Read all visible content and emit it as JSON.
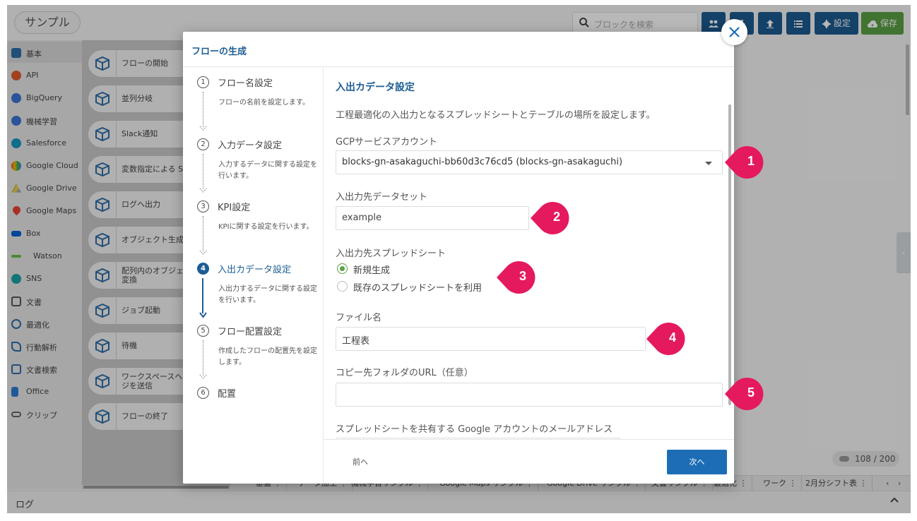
{
  "app": {
    "title": "サンプル",
    "search_placeholder": "ブロックを検索",
    "toolbar": {
      "settings_label": "設定",
      "save_label": "保存"
    }
  },
  "sidebar": {
    "items": [
      {
        "label": "基本",
        "icon": "basic-icon",
        "color": "#2f6ea8"
      },
      {
        "label": "API",
        "icon": "api-icon",
        "color": "#e05a2c"
      },
      {
        "label": "BigQuery",
        "icon": "bigquery-icon",
        "color": "#3b73d6"
      },
      {
        "label": "機械学習",
        "icon": "ml-icon",
        "color": "#3b73d6"
      },
      {
        "label": "Salesforce",
        "icon": "salesforce-icon",
        "color": "#1798c1"
      },
      {
        "label": "Google Cloud",
        "icon": "google-cloud-icon",
        "color": "#ea4335"
      },
      {
        "label": "Google Drive",
        "icon": "google-drive-icon",
        "color": "#1fa463"
      },
      {
        "label": "Google Maps",
        "icon": "google-maps-icon",
        "color": "#ea4335"
      },
      {
        "label": "Box",
        "icon": "box-icon",
        "color": "#0061d5"
      },
      {
        "label": "Watson",
        "icon": "watson-icon",
        "color": "#6bbd45"
      },
      {
        "label": "SNS",
        "icon": "sns-icon",
        "color": "#1ba4a4"
      },
      {
        "label": "文書",
        "icon": "document-icon",
        "color": "#555555"
      },
      {
        "label": "最適化",
        "icon": "optimization-icon",
        "color": "#2f6ea8"
      },
      {
        "label": "行動解析",
        "icon": "behavior-icon",
        "color": "#2f6ea8"
      },
      {
        "label": "文書検索",
        "icon": "doc-search-icon",
        "color": "#2f6ea8"
      },
      {
        "label": "Office",
        "icon": "office-icon",
        "color": "#2b7cd3"
      },
      {
        "label": "クリップ",
        "icon": "clip-icon",
        "color": "#666666"
      }
    ]
  },
  "blocks": [
    {
      "label": "フローの開始",
      "label2": ""
    },
    {
      "label": "並列分岐",
      "label2": ""
    },
    {
      "label": "Slack通知",
      "label2": ""
    },
    {
      "label": "変数指定による S",
      "label2": ""
    },
    {
      "label": "ログへ出力",
      "label2": ""
    },
    {
      "label": "オブジェクト生成",
      "label2": ""
    },
    {
      "label": "配列内のオブジェ",
      "label2": "変換"
    },
    {
      "label": "ジョブ起動",
      "label2": ""
    },
    {
      "label": "待機",
      "label2": ""
    },
    {
      "label": "ワークスペースへ",
      "label2": "ジを送信"
    },
    {
      "label": "フローの終了",
      "label2": ""
    }
  ],
  "bottom_tabs": [
    "基盤",
    "データ加工",
    "機械学習サンプル",
    "Google Maps サンプル",
    "Google Drive サンプル",
    "文書サンプル",
    "最適化",
    "ワーク",
    "2月分シフト表"
  ],
  "counter": "108 / 200",
  "log_label": "ログ",
  "modal": {
    "title": "フローの生成",
    "steps": [
      {
        "num": "1",
        "title": "フロー名設定",
        "desc": "フローの名前を設定します。"
      },
      {
        "num": "2",
        "title": "入力データ設定",
        "desc": "入力するデータに関する設定を行います。"
      },
      {
        "num": "3",
        "title": "KPI設定",
        "desc": "KPIに関する設定を行います。"
      },
      {
        "num": "4",
        "title": "入出カデータ設定",
        "desc": "入出力するデータに関する設定を行います。"
      },
      {
        "num": "5",
        "title": "フロー配置設定",
        "desc": "作成したフローの配置先を設定します。"
      },
      {
        "num": "6",
        "title": "配置",
        "desc": ""
      }
    ],
    "section_title": "入出カデータ設定",
    "section_desc": "工程最適化の入出力となるスプレッドシートとテーブルの場所を設定します。",
    "gcp_label": "GCPサービスアカウント",
    "gcp_value": "blocks-gn-asakaguchi-bb60d3c76cd5 (blocks-gn-asakaguchi)",
    "dataset_label": "入出力先データセット",
    "dataset_value": "example",
    "spreadsheet_label": "入出力先スプレッドシート",
    "radio_new": "新規生成",
    "radio_existing": "既存のスプレッドシートを利用",
    "filename_label": "ファイル名",
    "filename_value": "工程表",
    "copy_folder_label": "コピー先フォルダのURL（任意）",
    "copy_folder_value": "",
    "share_label": "スプレッドシートを共有する Google アカウントのメールアドレス",
    "prev_label": "前へ",
    "next_label": "次へ"
  },
  "badges": [
    "1",
    "2",
    "3",
    "4",
    "5"
  ],
  "colors": {
    "primary": "#1d5d94",
    "accent_green": "#5aa045",
    "badge": "#e5195e"
  }
}
